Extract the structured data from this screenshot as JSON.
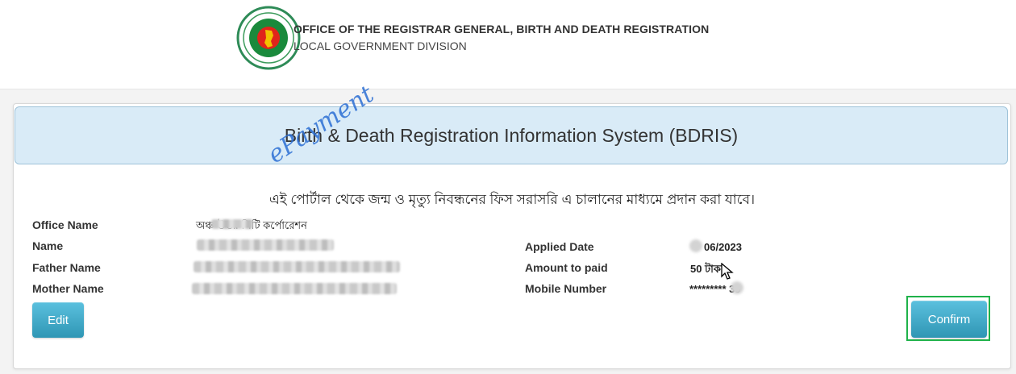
{
  "header": {
    "office_title": "OFFICE OF THE REGISTRAR GENERAL, BIRTH AND DEATH REGISTRATION",
    "office_sub": "LOCAL GOVERNMENT DIVISION",
    "logo_icon": "government-seal-icon"
  },
  "panel": {
    "heading": "Birth & Death Registration Information System (BDRIS)",
    "watermark": "ePayment",
    "notice": "এই পোর্টাল থেকে জন্ম ও মৃত্যু নিবন্ধনের ফিস সরাসরি এ চালানের মাধ্যমে প্রদান করা যাবে।"
  },
  "details_left": [
    {
      "label": "Office Name",
      "value": "অঞ্চ    উত্তর সিটি কর্পোরেশন"
    },
    {
      "label": "Name",
      "value": ""
    },
    {
      "label": "Father Name",
      "value": ""
    },
    {
      "label": "Mother Name",
      "value": ""
    }
  ],
  "details_right": [
    {
      "label": "Applied Date",
      "value": "06/2023"
    },
    {
      "label": "Amount to paid",
      "value": "50 টাকা"
    },
    {
      "label": "Mobile Number",
      "value": "*********     39"
    }
  ],
  "buttons": {
    "edit": "Edit",
    "confirm": "Confirm"
  },
  "colors": {
    "heading_bg": "#d9ebf7",
    "button": "#3aa3c6",
    "highlight": "#1fb24a",
    "watermark": "#2c6fd4"
  }
}
